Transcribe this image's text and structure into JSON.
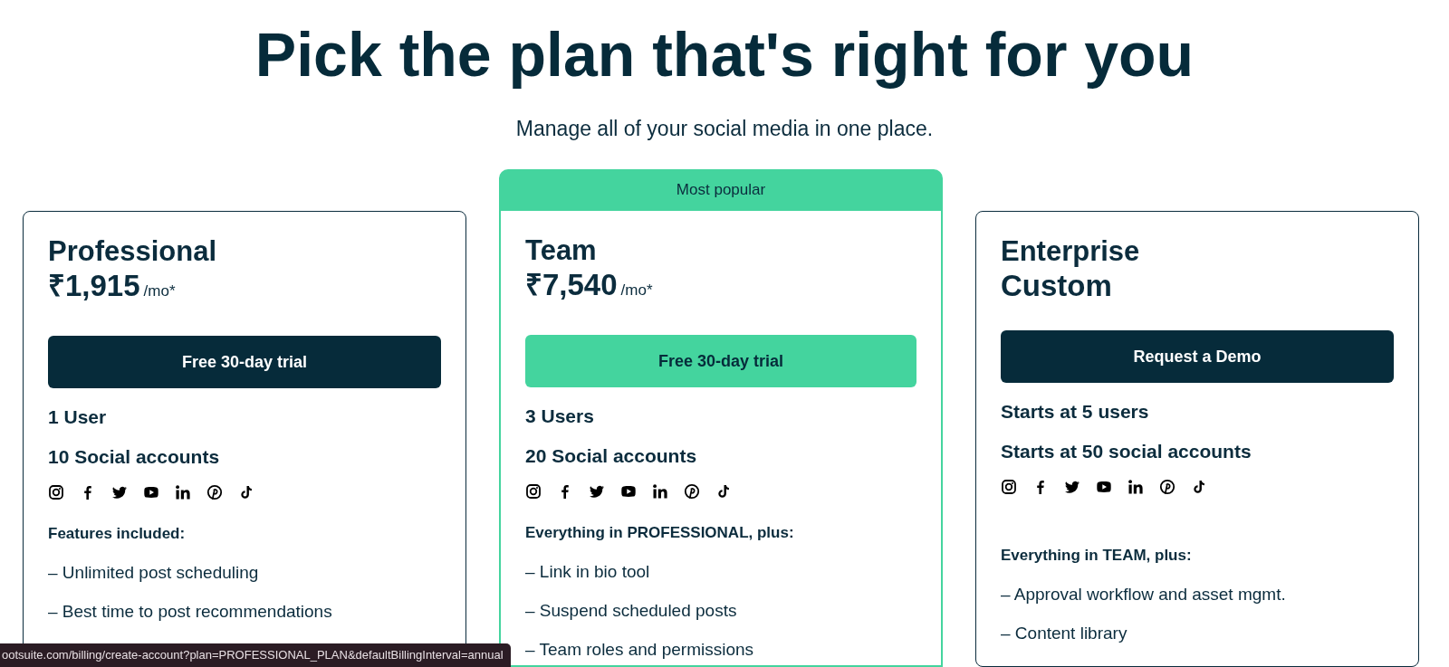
{
  "heading": "Pick the plan that's right for you",
  "subtitle": "Manage all of your social media in one place.",
  "plans": [
    {
      "name": "Professional",
      "price": "₹1,915",
      "price_suffix": "/mo*",
      "highlighted": false,
      "button": {
        "label": "Free 30-day trial",
        "kind": "dark"
      },
      "users": "1 User",
      "accounts": "10 Social accounts",
      "features_heading": "Features included:",
      "features": [
        "– Unlimited post scheduling",
        "– Best time to post recommendations"
      ]
    },
    {
      "name": "Team",
      "badge": "Most popular",
      "price": "₹7,540",
      "price_suffix": "/mo*",
      "highlighted": true,
      "button": {
        "label": "Free 30-day trial",
        "kind": "green"
      },
      "users": "3 Users",
      "accounts": "20 Social accounts",
      "features_heading": "Everything in PROFESSIONAL, plus:",
      "features": [
        "– Link in bio tool",
        "– Suspend scheduled posts",
        "– Team roles and permissions"
      ]
    },
    {
      "name": "Enterprise",
      "price": "Custom",
      "highlighted": false,
      "button": {
        "label": "Request a Demo",
        "kind": "dark"
      },
      "users": "Starts at 5 users",
      "accounts": "Starts at 50 social accounts",
      "features_heading": "Everything in TEAM, plus:",
      "features": [
        "– Approval workflow and asset mgmt.",
        "– Content library"
      ]
    }
  ],
  "status_url": "ootsuite.com/billing/create-account?plan=PROFESSIONAL_PLAN&defaultBillingInterval=annual"
}
